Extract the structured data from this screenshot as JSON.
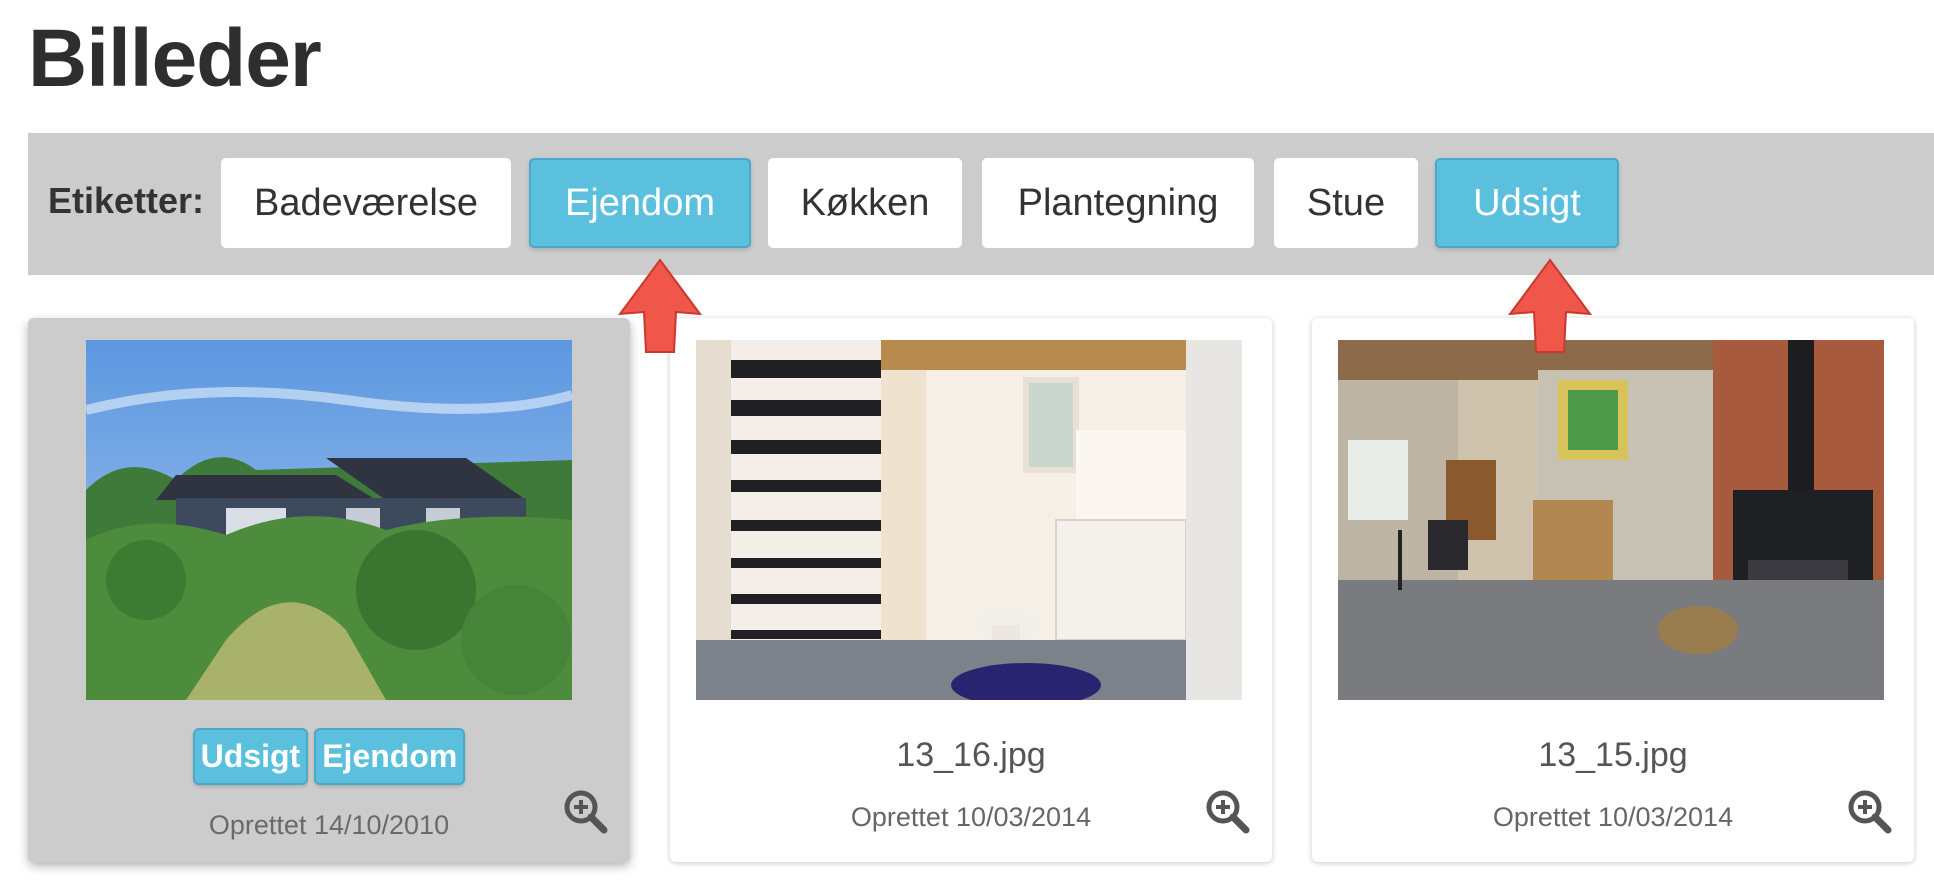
{
  "page": {
    "title": "Billeder"
  },
  "tag_bar": {
    "label": "Etiketter:",
    "tags": [
      {
        "label": "Badeværelse",
        "active": false
      },
      {
        "label": "Ejendom",
        "active": true
      },
      {
        "label": "Køkken",
        "active": false
      },
      {
        "label": "Plantegning",
        "active": false
      },
      {
        "label": "Stue",
        "active": false
      },
      {
        "label": "Udsigt",
        "active": true
      }
    ]
  },
  "colors": {
    "accent": "#5bc0de",
    "bar_bg": "#cccccc",
    "pointer": "#f0564a"
  },
  "cards": [
    {
      "tags": [
        "Udsigt",
        "Ejendom"
      ],
      "filename": "",
      "date": "Oprettet 14/10/2010",
      "highlighted": true,
      "scene": "house-exterior"
    },
    {
      "tags": [],
      "filename": "13_16.jpg",
      "date": "Oprettet 10/03/2014",
      "highlighted": false,
      "scene": "bathroom"
    },
    {
      "tags": [],
      "filename": "13_15.jpg",
      "date": "Oprettet 10/03/2014",
      "highlighted": false,
      "scene": "living-room"
    }
  ],
  "icons": {
    "zoom": "zoom-in-icon",
    "pointer": "arrow-up-icon"
  }
}
